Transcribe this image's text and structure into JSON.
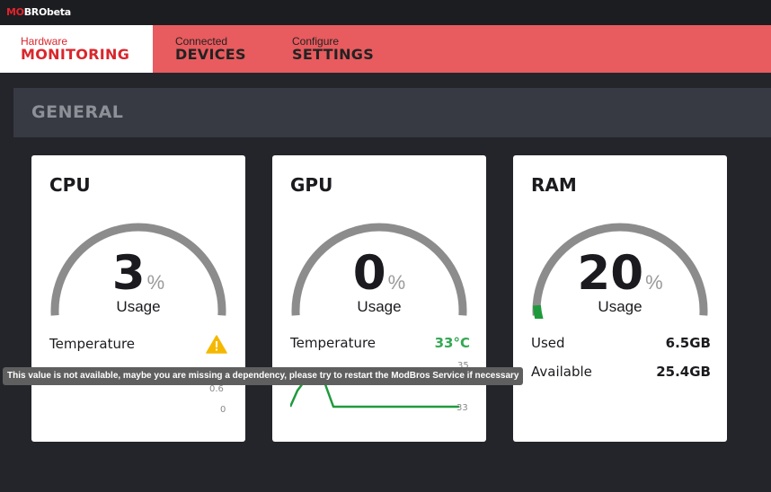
{
  "app": {
    "logo_mo": "MO",
    "logo_bro": "BRO",
    "logo_beta": "beta"
  },
  "nav": {
    "items": [
      {
        "small": "Hardware",
        "big": "MONITORING",
        "active": true
      },
      {
        "small": "Connected",
        "big": "DEVICES",
        "active": false
      },
      {
        "small": "Configure",
        "big": "SETTINGS",
        "active": false
      }
    ]
  },
  "section": {
    "title": "GENERAL"
  },
  "cards": {
    "cpu": {
      "title": "CPU",
      "usage_value": "3",
      "usage_unit": "%",
      "usage_label": "Usage",
      "usage_fraction": 0.03,
      "temperature_label": "Temperature",
      "ticks": [
        "0.6",
        "0"
      ]
    },
    "gpu": {
      "title": "GPU",
      "usage_value": "0",
      "usage_unit": "%",
      "usage_label": "Usage",
      "usage_fraction": 0.0,
      "temperature_label": "Temperature",
      "temperature_value": "33°C",
      "ticks": [
        "35",
        "33"
      ]
    },
    "ram": {
      "title": "RAM",
      "usage_value": "20",
      "usage_unit": "%",
      "usage_label": "Usage",
      "usage_fraction": 0.2,
      "used_label": "Used",
      "used_value": "6.5GB",
      "available_label": "Available",
      "available_value": "25.4GB"
    }
  },
  "tooltip": {
    "text": "This value is not available, maybe you are missing a dependency, please try to restart the ModBros Service if necessary"
  },
  "colors": {
    "nav_bg": "#e85b5e",
    "accent_red": "#d9262c",
    "gauge_track": "#8c8c8c",
    "gauge_fill": "#1e9a3c",
    "temp_green": "#34a853",
    "warning": "#f5b800"
  }
}
